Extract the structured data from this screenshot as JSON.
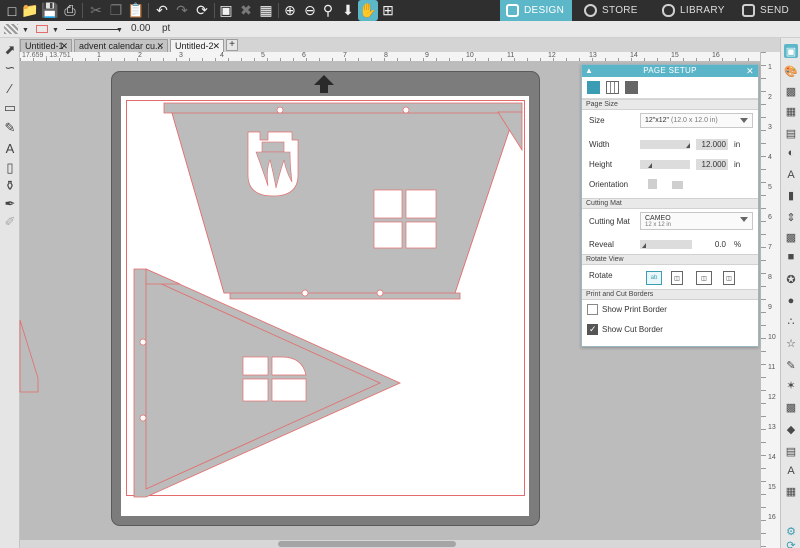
{
  "nav": {
    "design": "DESIGN",
    "store": "STORE",
    "library": "LIBRARY",
    "send": "SEND"
  },
  "subbar": {
    "line_width": "0.00",
    "line_unit": "pt"
  },
  "tabs": [
    {
      "label": "Untitled-1"
    },
    {
      "label": "advent calendar cu..."
    },
    {
      "label": "Untitled-2"
    }
  ],
  "coords": "17.659 , 13.751",
  "ruler_top": [
    "1",
    "2",
    "3",
    "4",
    "5",
    "6",
    "7",
    "8",
    "9",
    "10",
    "11",
    "12",
    "13",
    "14",
    "15",
    "16"
  ],
  "ruler_right": [
    "1",
    "2",
    "3",
    "4",
    "5",
    "6",
    "7",
    "8",
    "9",
    "10",
    "11",
    "12",
    "13",
    "14",
    "15",
    "16"
  ],
  "panel": {
    "title": "PAGE SETUP",
    "section_page_size": "Page Size",
    "size_label": "Size",
    "size_value": "12\"x12\"",
    "size_detail": "(12.0 x 12.0 in)",
    "width_label": "Width",
    "width_value": "12.000",
    "width_unit": "in",
    "height_label": "Height",
    "height_value": "12.000",
    "height_unit": "in",
    "orientation_label": "Orientation",
    "section_cutting_mat": "Cutting Mat",
    "mat_label": "Cutting Mat",
    "mat_value": "CAMEO",
    "mat_detail": "12 x 12 in",
    "reveal_label": "Reveal",
    "reveal_value": "0.0",
    "reveal_unit": "%",
    "section_rotate": "Rotate View",
    "rotate_label": "Rotate",
    "rotate_btn": "ab",
    "section_borders": "Print and Cut Borders",
    "show_print_border": "Show Print Border",
    "show_cut_border": "Show Cut Border",
    "print_border_checked": false,
    "cut_border_checked": true
  },
  "colors": {
    "accent": "#5cb7c9",
    "cut_line": "#e46c6c",
    "shape_fill": "#bcbcbc",
    "mat": "#7c7c7c"
  }
}
